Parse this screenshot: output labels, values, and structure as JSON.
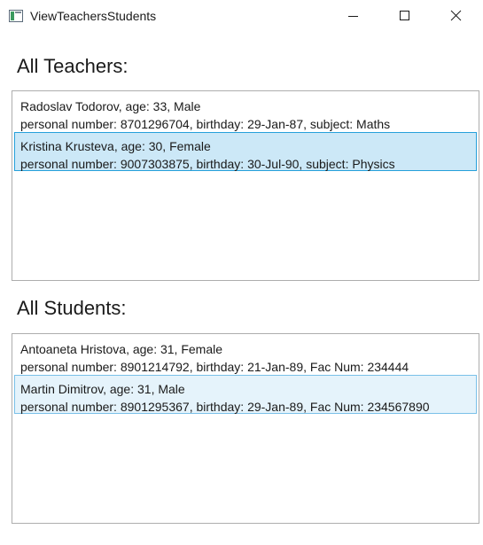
{
  "window": {
    "title": "ViewTeachersStudents"
  },
  "teachers": {
    "heading": "All Teachers:",
    "items": [
      {
        "line1": "Radoslav Todorov, age: 33, Male",
        "line2": "personal number: 8701296704, birthday: 29-Jan-87, subject: Maths"
      },
      {
        "line1": "Kristina Krusteva, age: 30, Female",
        "line2": "personal number: 9007303875, birthday: 30-Jul-90, subject: Physics",
        "selected": true
      }
    ]
  },
  "students": {
    "heading": "All Students:",
    "items": [
      {
        "line1": "Antoaneta Hristova, age: 31, Female",
        "line2": "personal number: 8901214792, birthday: 21-Jan-89, Fac Num: 234444"
      },
      {
        "line1": "Martin Dimitrov, age: 31, Male",
        "line2": "personal number: 8901295367, birthday: 29-Jan-89, Fac Num: 234567890",
        "selected": true
      }
    ]
  },
  "icons": {
    "app": "app-window-icon",
    "minimize": "minimize-icon",
    "maximize": "maximize-icon",
    "close": "close-icon"
  },
  "colors": {
    "selection_active_bg": "#cce8f7",
    "selection_active_border": "#26a0da",
    "selection_inactive_bg": "#e5f3fb",
    "selection_inactive_border": "#7ac0e8",
    "list_border": "#adadad"
  }
}
